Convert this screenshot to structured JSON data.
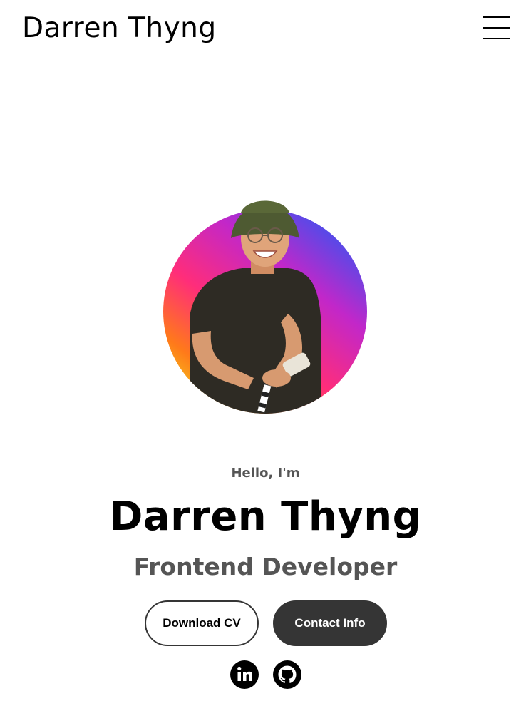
{
  "header": {
    "logo_text": "Darren Thyng",
    "menu_icon": "hamburger-menu-icon"
  },
  "hero": {
    "photo_alt": "Portrait of Darren Thyng",
    "photo_gradient": [
      "#3b52f0",
      "#c227c9",
      "#ff2d7a",
      "#ff8a1a",
      "#f5c21b"
    ],
    "greeting": "Hello, I'm",
    "name": "Darren Thyng",
    "role": "Frontend Developer"
  },
  "actions": {
    "download_cv_label": "Download CV",
    "contact_info_label": "Contact Info"
  },
  "social": {
    "linkedin_label": "LinkedIn",
    "github_label": "GitHub"
  },
  "colors": {
    "accent_dark": "#353535",
    "muted_text": "#555555"
  }
}
